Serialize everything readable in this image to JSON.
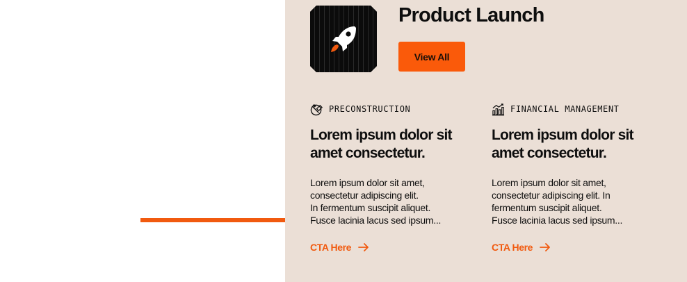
{
  "header": {
    "title": "Product Launch",
    "view_all_label": "View All",
    "logo_icon": "rocket-icon"
  },
  "cards": [
    {
      "tag_icon": "construction-tools-icon",
      "tag": "PRECONSTRUCTION",
      "heading": "Lorem ipsum dolor sit amet consectetur.",
      "body_lines": [
        "Lorem ipsum dolor sit amet,",
        "consectetur adipiscing elit.",
        "In fermentum suscipit aliquet.",
        "Fusce lacinia lacus sed ipsum..."
      ],
      "cta": "CTA Here"
    },
    {
      "tag_icon": "bar-chart-growth-icon",
      "tag": "FINANCIAL MANAGEMENT",
      "heading": "Lorem ipsum dolor sit amet consectetur.",
      "body_lines": [
        "Lorem ipsum dolor sit amet,",
        "consectetur adipiscing elit. In",
        "fermentum suscipit aliquet.",
        "Fusce lacinia lacus sed ipsum..."
      ],
      "cta": "CTA Here"
    }
  ],
  "colors": {
    "accent": "#f15a0f",
    "panel_background": "#ebdfd6",
    "text": "#0e0e0e"
  }
}
